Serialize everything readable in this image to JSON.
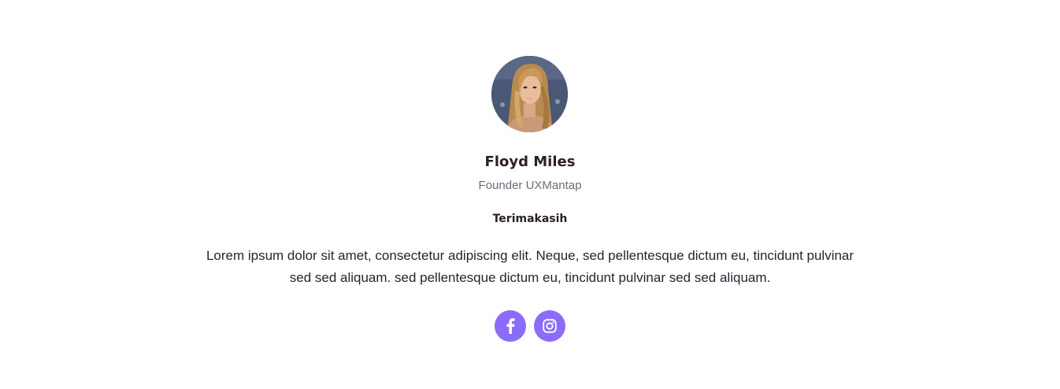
{
  "profile": {
    "name": "Floyd Miles",
    "role": "Founder UXMantap",
    "greeting": "Terimakasih",
    "quote": "Lorem ipsum dolor sit amet, consectetur adipiscing elit. Neque, sed pellentesque dictum eu, tincidunt pulvinar sed sed aliquam. sed pellentesque dictum eu, tincidunt pulvinar sed sed aliquam."
  },
  "socials": [
    {
      "icon": "facebook-icon"
    },
    {
      "icon": "instagram-icon"
    }
  ],
  "colors": {
    "accent": "#8b6cf6",
    "text_dark": "#2a1f2a",
    "text_muted": "#6c6b7e"
  }
}
